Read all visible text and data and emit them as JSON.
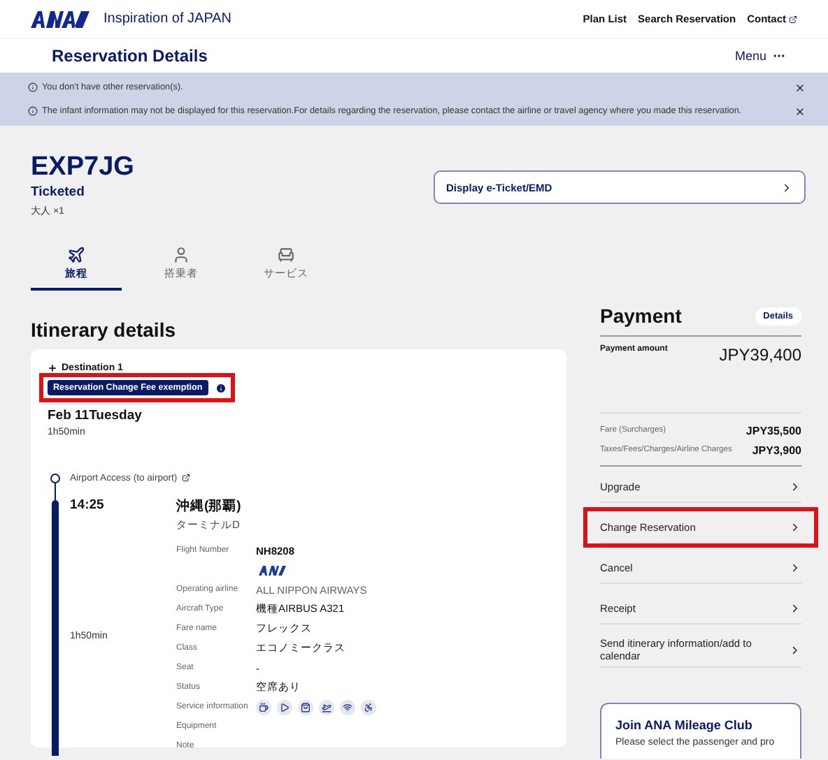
{
  "header": {
    "tagline": "Inspiration of JAPAN",
    "nav": [
      "Plan List",
      "Search Reservation",
      "Contact"
    ]
  },
  "subheader": {
    "title": "Reservation Details",
    "menu": "Menu"
  },
  "notices": [
    "You don't have other reservation(s).",
    "The infant information may not be displayed for this reservation.For details regarding the reservation, please contact the airline or travel agency where you made this reservation."
  ],
  "booking": {
    "code": "EXP7JG",
    "status": "Ticketed",
    "passengers": "大人 ×1",
    "eticket_button": "Display e-Ticket/EMD"
  },
  "tabs": [
    {
      "label": "旅程",
      "selected": true,
      "kind": "plane"
    },
    {
      "label": "搭乗者",
      "selected": false,
      "kind": "person"
    },
    {
      "label": "サービス",
      "selected": false,
      "kind": "seat"
    }
  ],
  "itinerary": {
    "heading": "Itinerary details",
    "destination": "Destination 1",
    "badge": "Reservation Change Fee exemption",
    "badge_highlighted": true,
    "date": "Feb 11Tuesday",
    "total_duration": "1h50min",
    "airport_access": "Airport Access (to airport)",
    "segment": {
      "time": "14:25",
      "airport": "沖縄(那覇)",
      "terminal": "ターミナルD",
      "duration": "1h50min",
      "details": [
        {
          "label": "Flight Number",
          "value": "NH8208",
          "kind": "bold"
        },
        {
          "kind": "logo"
        },
        {
          "label": "Operating airline",
          "value": "ALL NIPPON AIRWAYS",
          "kind": "muted"
        },
        {
          "label": "Aircraft Type",
          "value": "機種AIRBUS A321",
          "kind": "plain"
        },
        {
          "label": "Fare name",
          "value": "フレックス",
          "kind": "plain"
        },
        {
          "label": "Class",
          "value": "エコノミークラス",
          "kind": "plain"
        },
        {
          "label": "Seat",
          "value": "-",
          "kind": "plain"
        },
        {
          "label": "Status",
          "value": "空席あり",
          "kind": "plain"
        },
        {
          "label": "Service information",
          "kind": "services"
        },
        {
          "label": "Equipment",
          "kind": "plain"
        },
        {
          "label": "Note",
          "kind": "plain"
        }
      ]
    }
  },
  "payment": {
    "heading": "Payment",
    "details_button": "Details",
    "amount_label": "Payment amount",
    "amount": "JPY39,400",
    "breakdown": [
      {
        "label": "Fare (Surcharges)",
        "value": "JPY35,500"
      },
      {
        "label": "Taxes/Fees/Charges/Airline Charges",
        "value": "JPY3,900"
      }
    ],
    "actions": [
      {
        "label": "Upgrade",
        "highlighted": false
      },
      {
        "label": "Change Reservation",
        "highlighted": true
      },
      {
        "label": "Cancel",
        "highlighted": false
      },
      {
        "label": "Receipt",
        "highlighted": false
      },
      {
        "label": "Send itinerary information/add to calendar",
        "highlighted": false
      }
    ]
  },
  "mileage": {
    "title": "Join ANA Mileage Club",
    "text": "Please select the passenger and pro"
  }
}
